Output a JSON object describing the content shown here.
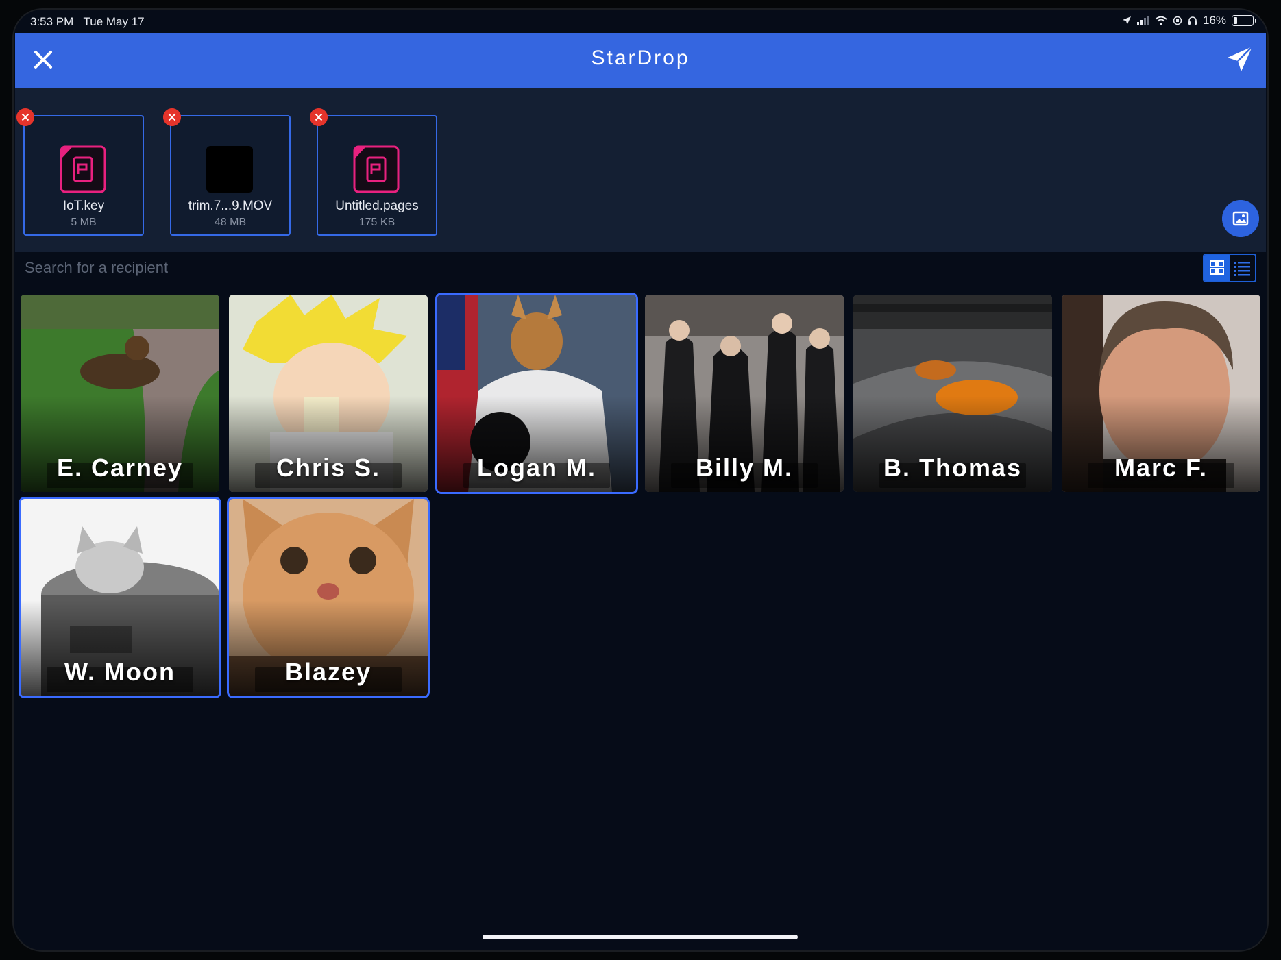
{
  "status_bar": {
    "time": "3:53 PM",
    "date": "Tue May 17",
    "battery": "16%",
    "battery_level": 0.16
  },
  "header": {
    "title": "StarDrop"
  },
  "files": [
    {
      "name": "IoT.key",
      "size": "5 MB",
      "icon": "document-icon"
    },
    {
      "name": "trim.7...9.MOV",
      "size": "48 MB",
      "icon": "video-thumbnail"
    },
    {
      "name": "Untitled.pages",
      "size": "175 KB",
      "icon": "document-icon"
    }
  ],
  "search": {
    "placeholder": "Search for a recipient"
  },
  "recipients": [
    {
      "name": "E. Carney",
      "selected": false,
      "image": "german-shepherd-on-lawn"
    },
    {
      "name": "Chris S.",
      "selected": false,
      "image": "anime-character-eating-noodles"
    },
    {
      "name": "Logan M.",
      "selected": true,
      "image": "chihuahua-in-astronaut-suit"
    },
    {
      "name": "Billy M.",
      "selected": false,
      "image": "people-dancing-on-stage"
    },
    {
      "name": "B. Thomas",
      "selected": false,
      "image": "race-cars-on-track"
    },
    {
      "name": "Marc F.",
      "selected": false,
      "image": "man-portrait"
    },
    {
      "name": "W. Moon",
      "selected": true,
      "image": "cat-in-sleepypod-bed"
    },
    {
      "name": "Blazey",
      "selected": true,
      "image": "orange-cat-closeup"
    }
  ],
  "colors": {
    "accent": "#3566e0",
    "file_card_border": "#3569e6",
    "remove_badge": "#e5342b",
    "doc_icon": "#e8217f",
    "background": "#060c18"
  }
}
